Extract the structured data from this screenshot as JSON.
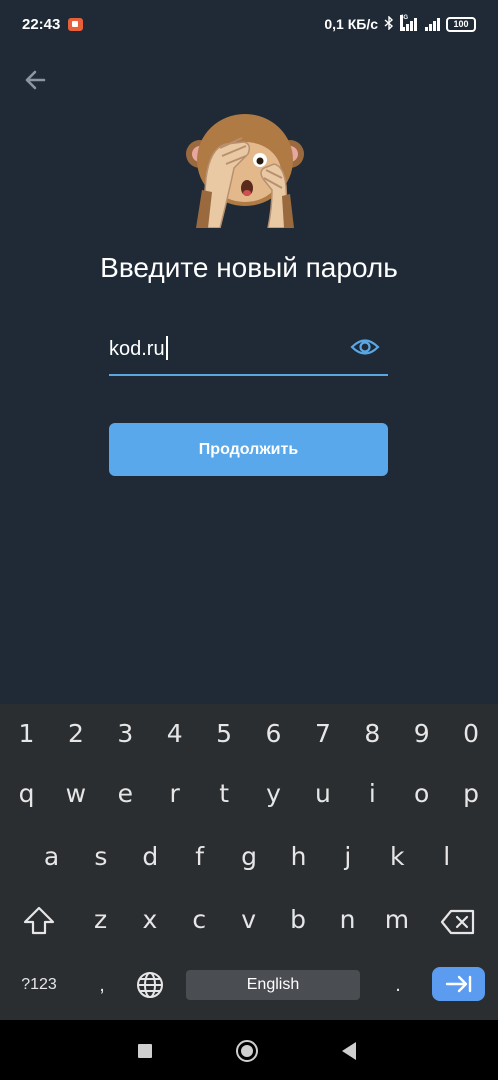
{
  "status_bar": {
    "time": "22:43",
    "network_speed": "0,1 КБ/с",
    "network_type": "4G",
    "battery": "100"
  },
  "icons": {
    "back": "arrow-left-icon",
    "sticker": "monkey-covering-eyes-sticker",
    "eye": "eye-icon",
    "shift": "shift-icon",
    "backspace": "backspace-icon",
    "globe": "globe-icon",
    "enter": "enter-arrow-icon"
  },
  "screen": {
    "title": "Введите новый пароль",
    "password_value": "kod.ru",
    "continue_label": "Продолжить"
  },
  "keyboard": {
    "number_row": [
      "1",
      "2",
      "3",
      "4",
      "5",
      "6",
      "7",
      "8",
      "9",
      "0"
    ],
    "row1": [
      "q",
      "w",
      "e",
      "r",
      "t",
      "y",
      "u",
      "i",
      "o",
      "p"
    ],
    "row2": [
      "a",
      "s",
      "d",
      "f",
      "g",
      "h",
      "j",
      "k",
      "l"
    ],
    "row3": [
      "z",
      "x",
      "c",
      "v",
      "b",
      "n",
      "m"
    ],
    "symbols_label": "?123",
    "comma": ",",
    "space_label": "English",
    "period": "."
  },
  "colors": {
    "background": "#1f2a36",
    "accent": "#58a8eb",
    "keyboard_bg": "#2b2e31",
    "enter_key": "#5b9cf0"
  }
}
